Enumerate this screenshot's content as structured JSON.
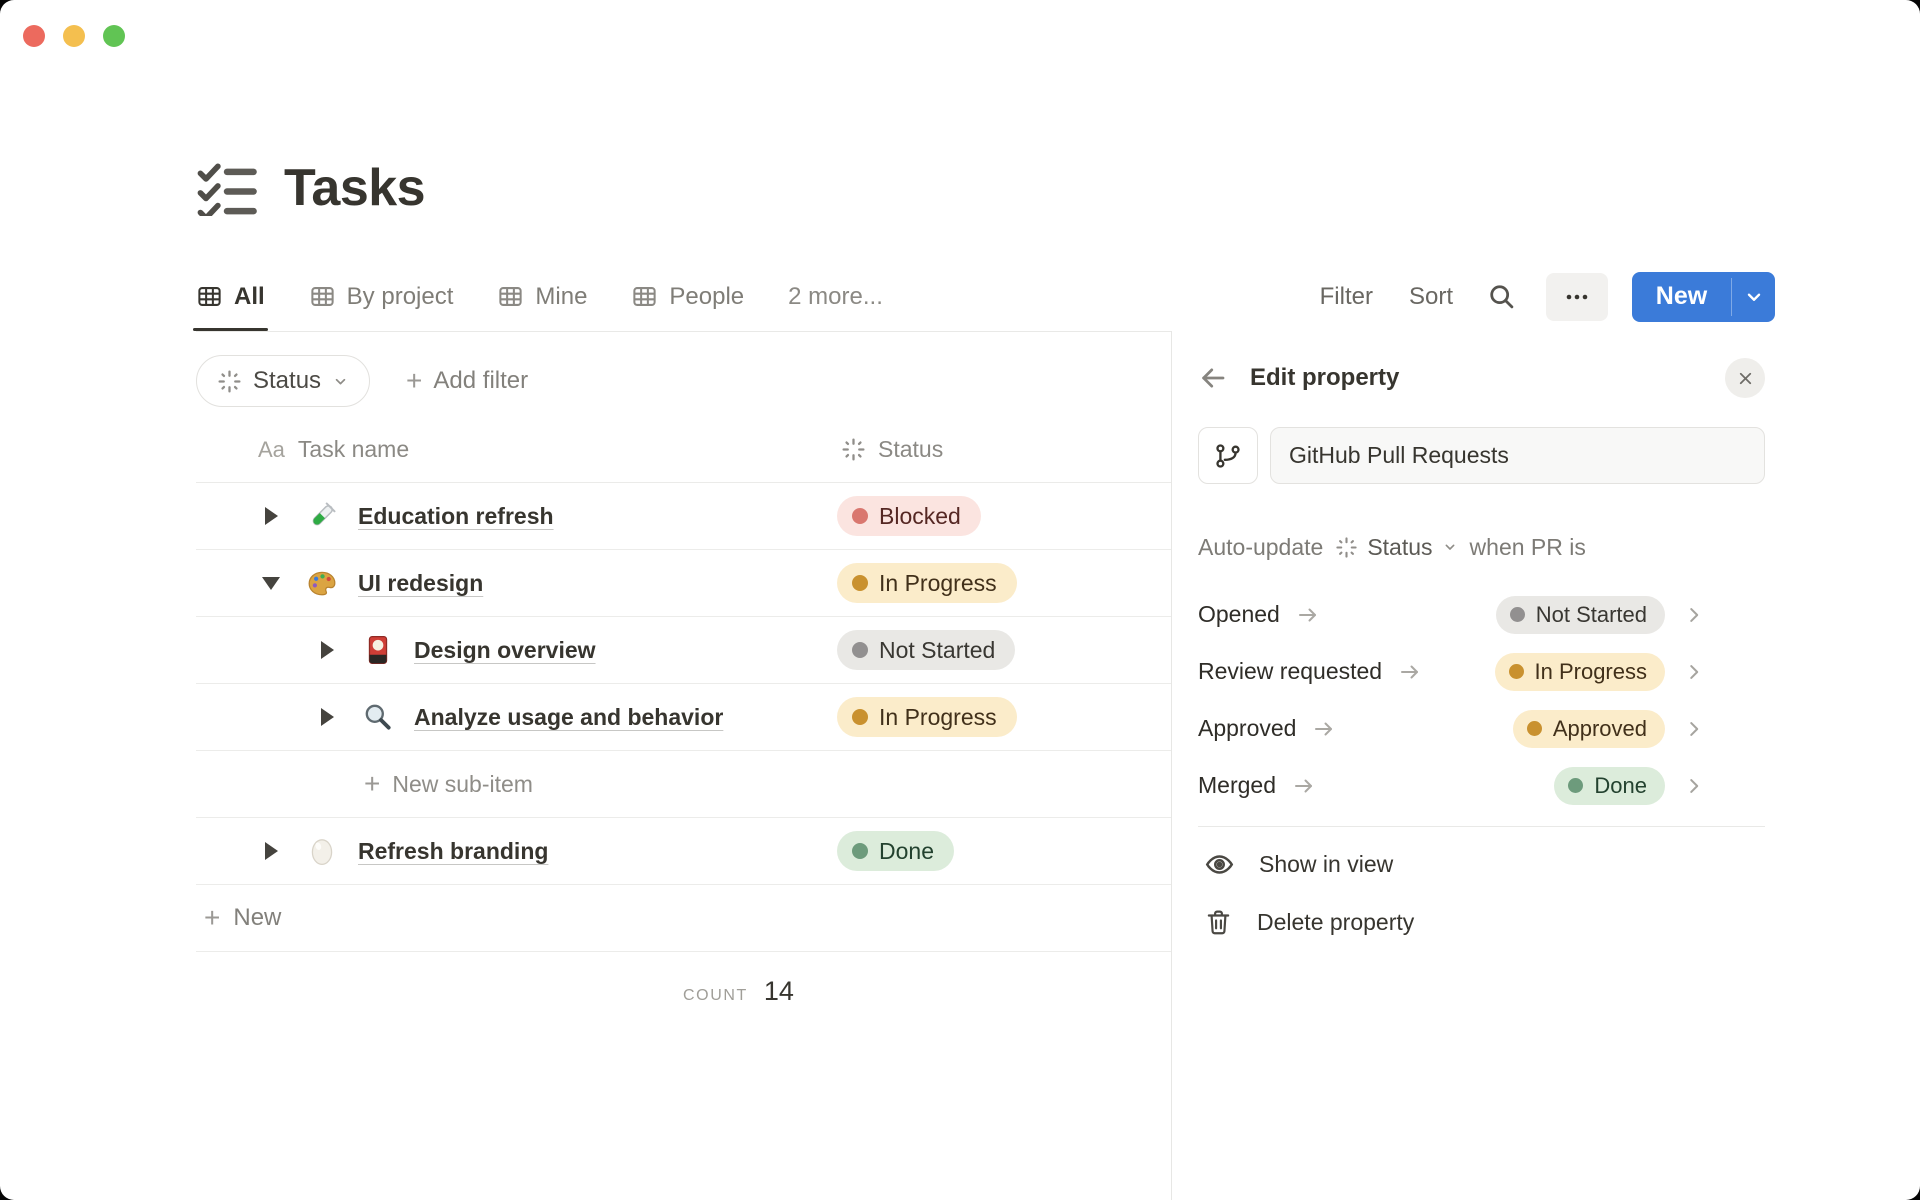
{
  "page": {
    "title": "Tasks",
    "title_icon": "checklist-icon"
  },
  "view_tabs": {
    "tabs": [
      {
        "label": "All",
        "icon": "table-view-icon",
        "active": true
      },
      {
        "label": "By project",
        "icon": "table-view-icon",
        "active": false
      },
      {
        "label": "Mine",
        "icon": "table-view-icon",
        "active": false
      },
      {
        "label": "People",
        "icon": "table-view-icon",
        "active": false
      }
    ],
    "more_label": "2 more..."
  },
  "toolbar": {
    "filter_label": "Filter",
    "sort_label": "Sort",
    "search_icon": "search-icon",
    "more_icon": "ellipsis-icon",
    "new_label": "New"
  },
  "filter_bar": {
    "status_label": "Status",
    "status_icon": "status-burst-icon",
    "add_filter_label": "Add filter"
  },
  "table": {
    "header": {
      "name_icon_text": "Aa",
      "name_label": "Task name",
      "status_icon": "status-burst-icon",
      "status_label": "Status"
    },
    "rows": [
      {
        "name": "Education refresh",
        "icon": "test-tube-icon",
        "status": "Blocked",
        "status_color": "red",
        "level": 0,
        "expanded": false
      },
      {
        "name": "UI redesign",
        "icon": "palette-icon",
        "status": "In Progress",
        "status_color": "yellow",
        "level": 0,
        "expanded": true
      },
      {
        "name": "Design overview",
        "icon": "flower-card-icon",
        "status": "Not Started",
        "status_color": "gray",
        "level": 1,
        "expanded": false
      },
      {
        "name": "Analyze usage and behavior",
        "icon": "magnifier-icon",
        "status": "In Progress",
        "status_color": "yellow",
        "level": 1,
        "expanded": false
      },
      {
        "name": "Refresh branding",
        "icon": "egg-icon",
        "status": "Done",
        "status_color": "green",
        "level": 0,
        "expanded": false
      }
    ],
    "new_sub_item_label": "New sub-item",
    "new_label": "New",
    "count_label": "COUNT",
    "count_value": "14"
  },
  "edit_panel": {
    "title": "Edit property",
    "property_icon": "git-pull-request-icon",
    "property_name": "GitHub Pull Requests",
    "auto_update": {
      "prefix": "Auto-update",
      "property": "Status",
      "property_icon": "status-burst-icon",
      "suffix": "when PR is"
    },
    "mappings": [
      {
        "trigger": "Opened",
        "status": "Not Started",
        "color": "gray"
      },
      {
        "trigger": "Review requested",
        "status": "In Progress",
        "color": "yellow"
      },
      {
        "trigger": "Approved",
        "status": "Approved",
        "color": "yellow"
      },
      {
        "trigger": "Merged",
        "status": "Done",
        "color": "green"
      }
    ],
    "actions": [
      {
        "label": "Show in view",
        "icon": "eye-icon"
      },
      {
        "label": "Delete property",
        "icon": "trash-icon"
      }
    ]
  },
  "colors": {
    "accent_blue": "#3b7bd9",
    "text_dark": "#37352f",
    "text_gray": "#787774",
    "border": "#e9e9e7",
    "pill_red_bg": "#fbe4e0",
    "pill_red_dot": "#d9776f",
    "pill_yellow_bg": "#fbecca",
    "pill_yellow_dot": "#c9912f",
    "pill_gray_bg": "#e9e8e5",
    "pill_gray_dot": "#929090",
    "pill_green_bg": "#dcecdb",
    "pill_green_dot": "#6d9b7c",
    "traffic_red": "#ec6a5e",
    "traffic_yellow": "#f4bf4f",
    "traffic_green": "#61c454"
  }
}
